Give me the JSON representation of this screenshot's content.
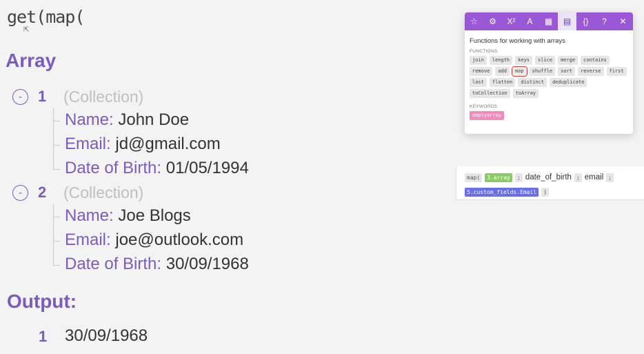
{
  "formula": "get(map(",
  "sections": {
    "array": "Array",
    "output": "Output:"
  },
  "items": [
    {
      "index": "1",
      "type": "(Collection)",
      "fields": [
        {
          "key": "Name:",
          "value": "John Doe"
        },
        {
          "key": "Email:",
          "value": "jd@gmail.com"
        },
        {
          "key": "Date of Birth:",
          "value": "01/05/1994"
        }
      ]
    },
    {
      "index": "2",
      "type": "(Collection)",
      "fields": [
        {
          "key": "Name:",
          "value": "Joe Blogs"
        },
        {
          "key": "Email:",
          "value": "joe@outlook.com"
        },
        {
          "key": "Date of Birth:",
          "value": "30/09/1968"
        }
      ]
    }
  ],
  "output": {
    "index": "1",
    "value": "30/09/1968"
  },
  "popup": {
    "tabs": [
      {
        "icon": "star-icon",
        "glyph": "☆"
      },
      {
        "icon": "gear-icon",
        "glyph": "⚙"
      },
      {
        "icon": "superscript-icon",
        "glyph": "X²"
      },
      {
        "icon": "text-icon",
        "glyph": "A"
      },
      {
        "icon": "calendar-icon",
        "glyph": "▦"
      },
      {
        "icon": "table-icon",
        "glyph": "▤",
        "active": true
      },
      {
        "icon": "braces-icon",
        "glyph": "{}"
      },
      {
        "icon": "help-icon",
        "glyph": "?"
      },
      {
        "icon": "close-icon",
        "glyph": "✕"
      }
    ],
    "title": "Functions for working with arrays",
    "functions_label": "FUNCTIONS",
    "functions": [
      "join",
      "length",
      "keys",
      "slice",
      "merge",
      "contains",
      "remove",
      "add",
      "map",
      "shuffle",
      "sort",
      "reverse",
      "first",
      "last",
      "flatten",
      "distinct",
      "deduplicate",
      "toCollection",
      "toArray"
    ],
    "selected": "map",
    "keywords_label": "KEYWORDS",
    "keywords": [
      "emptyarray"
    ]
  },
  "formula_box": {
    "fn": "map(",
    "arg1": "3.array",
    "sep": ";",
    "t1": "date_of_birth",
    "t2": "email",
    "arg2": "5.custom_fields.Email",
    "close": ")"
  },
  "colors": {
    "accent": "#7b5bbf",
    "tabbar": "#9a57d6",
    "keyword": "#f08bbd",
    "green": "#8cc968",
    "blue": "#6a6ee8"
  }
}
